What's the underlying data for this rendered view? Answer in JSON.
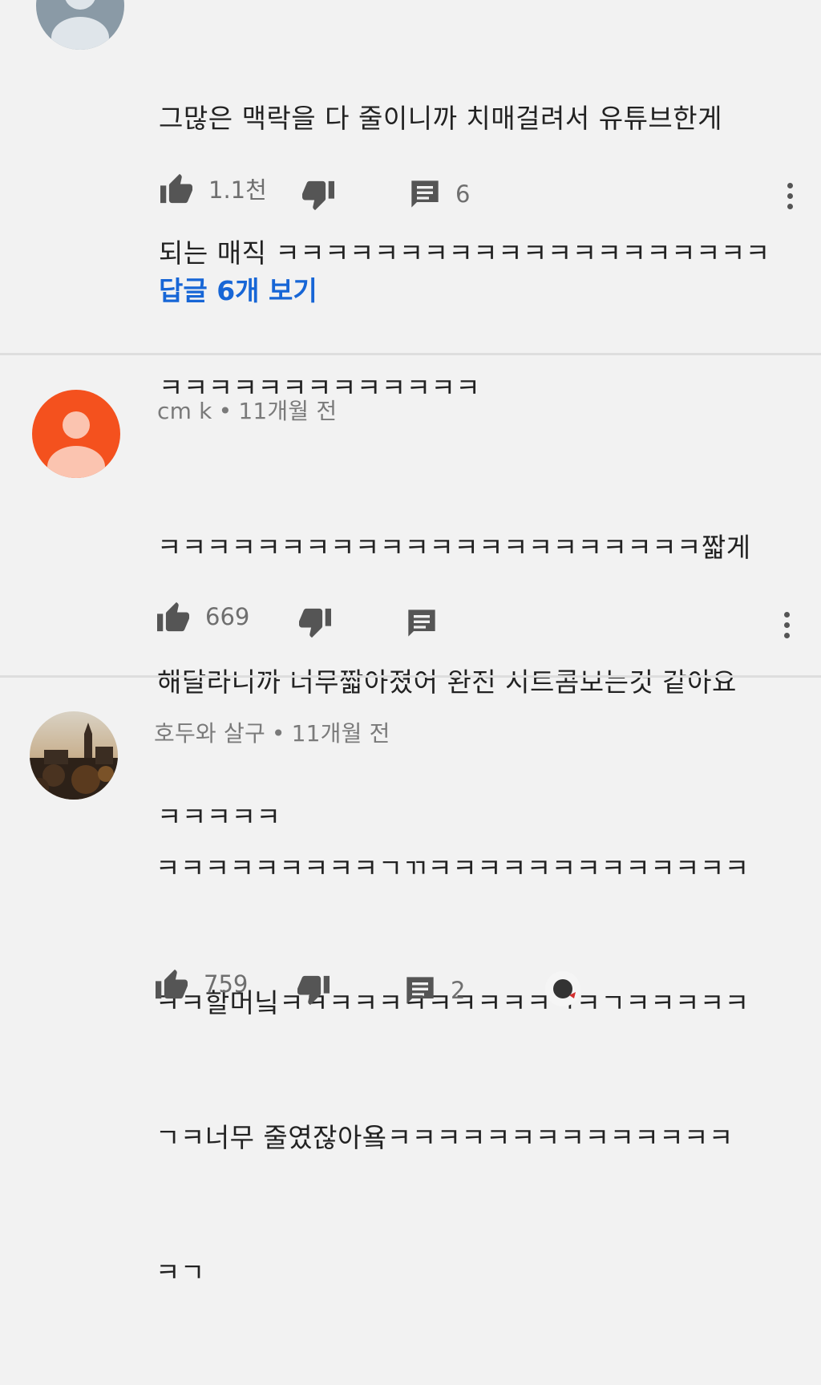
{
  "comments": [
    {
      "author": "",
      "time": "",
      "lines": [
        "그많은 맥락을 다 줄이니까 치매걸려서 유튜브한게",
        "되는 매직 ㅋㅋㅋㅋㅋㅋㅋㅋㅋㅋㅋㅋㅋㅋㅋㅋㅋㅋㅋㅋ",
        "ㅋㅋㅋㅋㅋㅋㅋㅋㅋㅋㅋㅋㅋ"
      ],
      "likes": "1.1천",
      "reply_count": "6",
      "view_replies": "답글 6개 보기"
    },
    {
      "author": "cm k",
      "time": "11개월 전",
      "lines": [
        "ㅋㅋㅋㅋㅋㅋㅋㅋㅋㅋㅋㅋㅋㅋㅋㅋㅋㅋㅋㅋㅋㅋ짧게",
        "해달라니까 너무짧아졌어 완전 시트콤보는것 같아요",
        "ㅋㅋㅋㅋㅋ"
      ],
      "likes": "669",
      "reply_count": ""
    },
    {
      "author": "호두와 살구",
      "time": "11개월 전",
      "lines": [
        "ㅋㅋㅋㅋㅋㅋㅋㅋㅋㄱㄲㅋㅋㅋㅋㅋㅋㅋㅋㅋㅋㅋㅋㅋ",
        "ㅋㅋ할머닠ㅋㅋㅋㅋㅋㅋㅋㅋㅋㅋㅋㄱㅋㄱㅋㅋㅋㅋㅋ",
        "ㄱㅋ너무 줄였잖아욬ㅋㅋㅋㅋㅋㅋㅋㅋㅋㅋㅋㅋㅋㅋ",
        "ㅋㄱ"
      ],
      "likes": "759",
      "reply_count": "2"
    }
  ],
  "icons": {
    "like": "thumbs-up-icon",
    "dislike": "thumbs-down-icon",
    "reply": "comment-icon",
    "more": "more-vert-icon"
  },
  "colors": {
    "background": "#f2f2f2",
    "link": "#1766d6",
    "avatar_orange": "#f4511e",
    "avatar_grey": "#8a9aa6"
  }
}
